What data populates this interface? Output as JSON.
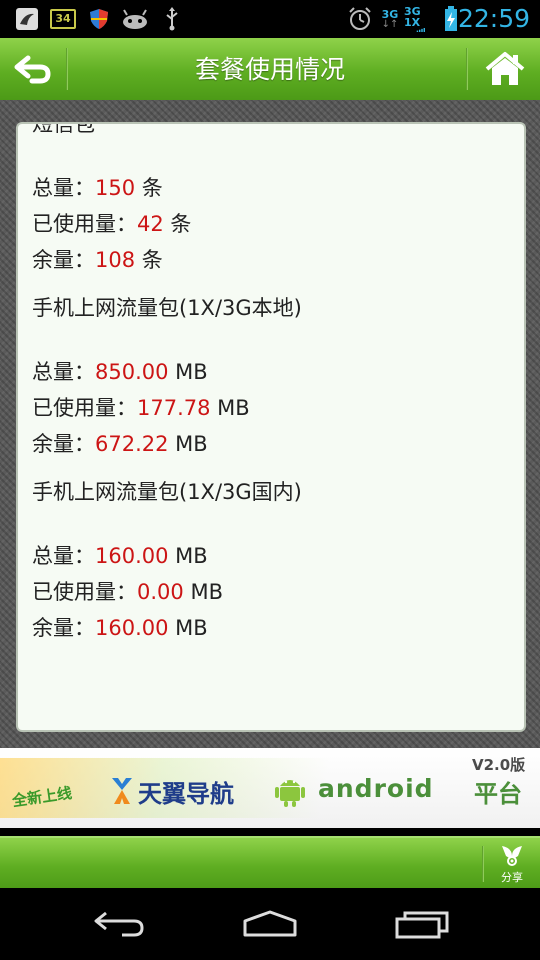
{
  "status_bar": {
    "badge_number": "34",
    "net_type_1": "3G",
    "net_type_2": "3G 1X",
    "time": "22:59"
  },
  "header": {
    "title": "套餐使用情况",
    "back_icon": "back-arrow-icon",
    "home_icon": "home-icon"
  },
  "usage": {
    "partial_title": "短信包",
    "sms": {
      "total": {
        "label": "总量：",
        "value": "150",
        "unit": "条"
      },
      "used": {
        "label": "已使用量：",
        "value": "42",
        "unit": "条"
      },
      "remain": {
        "label": "余量：",
        "value": "108",
        "unit": "条"
      }
    },
    "data_local": {
      "name": "手机上网流量包(1X/3G本地)",
      "total": {
        "label": "总量：",
        "value": "850.00",
        "unit": "MB"
      },
      "used": {
        "label": "已使用量：",
        "value": "177.78",
        "unit": "MB"
      },
      "remain": {
        "label": "余量：",
        "value": "672.22",
        "unit": "MB"
      }
    },
    "data_domestic": {
      "name": "手机上网流量包(1X/3G国内)",
      "total": {
        "label": "总量：",
        "value": "160.00",
        "unit": "MB"
      },
      "used": {
        "label": "已使用量：",
        "value": "0.00",
        "unit": "MB"
      },
      "remain": {
        "label": "余量：",
        "value": "160.00",
        "unit": "MB"
      }
    }
  },
  "banner": {
    "tag": "全新上线",
    "nav_text": "天翼导航",
    "android_text": "android",
    "platform_text": "平台",
    "version": "V2.0版"
  },
  "bottom_bar": {
    "share_label": "分享"
  },
  "colors": {
    "accent_green": "#5fae22",
    "value_red": "#cc1515",
    "time_blue": "#33b5e5"
  }
}
